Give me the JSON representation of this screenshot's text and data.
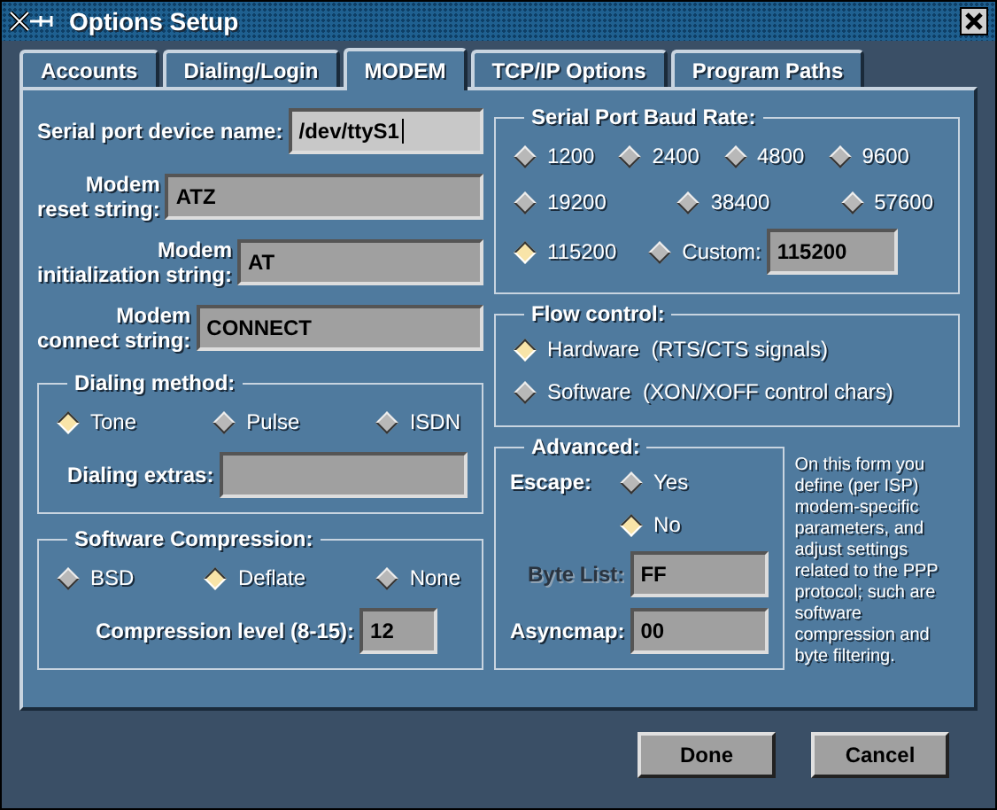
{
  "window": {
    "title": "Options Setup"
  },
  "tabs": [
    {
      "label": "Accounts",
      "selected": false
    },
    {
      "label": "Dialing/Login",
      "selected": false
    },
    {
      "label": "MODEM",
      "selected": true
    },
    {
      "label": "TCP/IP Options",
      "selected": false
    },
    {
      "label": "Program Paths",
      "selected": false
    }
  ],
  "fields": [
    {
      "label": "Serial port device name:",
      "value": "/dev/ttyS1",
      "focused": true
    },
    {
      "label": "Modem\nreset string:",
      "value": "ATZ",
      "focused": false
    },
    {
      "label": "Modem\ninitialization string:",
      "value": "AT",
      "focused": false
    },
    {
      "label": "Modem\nconnect string:",
      "value": "CONNECT",
      "focused": false
    }
  ],
  "dialing_method": {
    "title": "Dialing method:",
    "options": [
      {
        "label": "Tone",
        "selected": true
      },
      {
        "label": "Pulse",
        "selected": false
      },
      {
        "label": "ISDN",
        "selected": false
      }
    ],
    "extras": {
      "label": "Dialing extras:"
    }
  },
  "compression": {
    "title": "Software Compression:",
    "options": [
      {
        "label": "BSD",
        "selected": false
      },
      {
        "label": "Deflate",
        "selected": true
      },
      {
        "label": "None",
        "selected": false
      }
    ],
    "level": {
      "label": "Compression level (8-15):",
      "value": "12"
    }
  },
  "baud_rate": {
    "title": "Serial Port Baud Rate:",
    "options": [
      {
        "label": "1200",
        "selected": false
      },
      {
        "label": "2400",
        "selected": false
      },
      {
        "label": "4800",
        "selected": false
      },
      {
        "label": "9600",
        "selected": false
      },
      {
        "label": "19200",
        "selected": false
      },
      {
        "label": "38400",
        "selected": false
      },
      {
        "label": "57600",
        "selected": false
      },
      {
        "label": "115200",
        "selected": true
      }
    ],
    "custom": {
      "label": "Custom:",
      "selected": false,
      "value": "115200"
    }
  },
  "flow_control": {
    "title": "Flow control:",
    "options": [
      {
        "label": "Hardware  (RTS/CTS signals)",
        "selected": true
      },
      {
        "label": "Software  (XON/XOFF control chars)",
        "selected": false
      }
    ]
  },
  "advanced": {
    "title": "Advanced:",
    "escape": {
      "label": "Escape:",
      "options": [
        {
          "label": "Yes",
          "selected": false
        },
        {
          "label": "No",
          "selected": true
        }
      ]
    },
    "byte_list": {
      "label": "Byte List:",
      "value": "FF",
      "disabled": true
    },
    "asyncmap": {
      "label": "Asyncmap:",
      "value": "00",
      "disabled": false
    }
  },
  "help_text": "On this form you define (per ISP) modem-specific parameters, and adjust settings related to the PPP protocol; such are software compression and byte filtering.",
  "buttons": [
    "Done",
    "Cancel"
  ]
}
